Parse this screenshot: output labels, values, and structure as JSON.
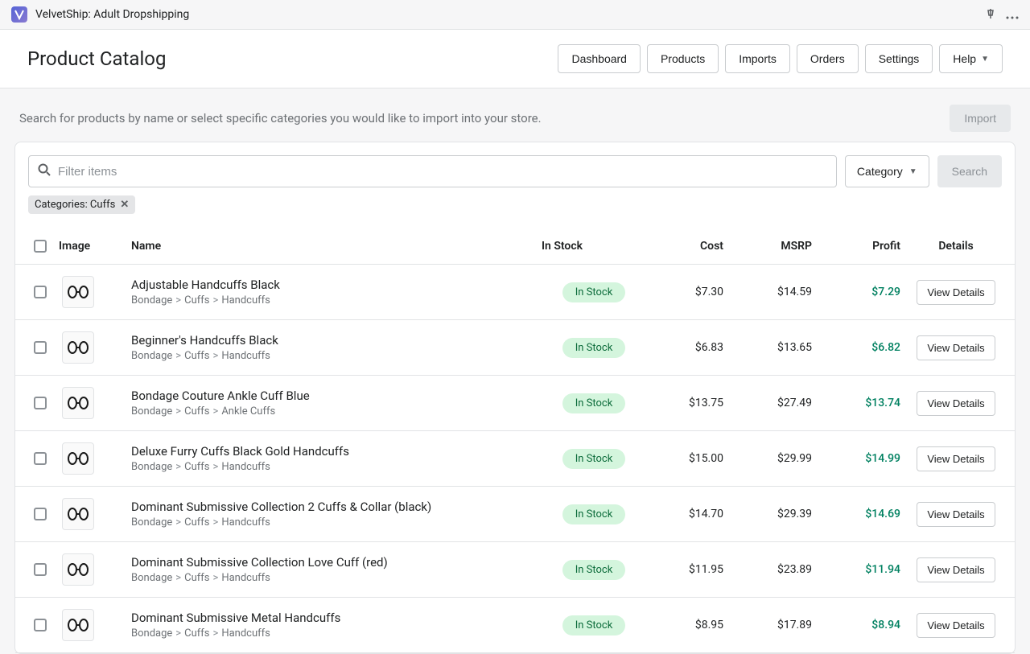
{
  "titlebar": {
    "app_name": "VelvetShip: Adult Dropshipping"
  },
  "header": {
    "page_title": "Product Catalog",
    "nav": {
      "dashboard": "Dashboard",
      "products": "Products",
      "imports": "Imports",
      "orders": "Orders",
      "settings": "Settings",
      "help": "Help"
    }
  },
  "subbar": {
    "text": "Search for products by name or select specific categories you would like to import into your store.",
    "import_label": "Import"
  },
  "filters": {
    "search_placeholder": "Filter items",
    "category_label": "Category",
    "search_label": "Search",
    "chip_label": "Categories: Cuffs"
  },
  "table": {
    "headers": {
      "image": "Image",
      "name": "Name",
      "stock": "In Stock",
      "cost": "Cost",
      "msrp": "MSRP",
      "profit": "Profit",
      "details": "Details"
    },
    "stock_label": "In Stock",
    "details_label": "View Details",
    "rows": [
      {
        "name": "Adjustable Handcuffs Black",
        "crumb1": "Bondage",
        "crumb2": "Cuffs",
        "crumb3": "Handcuffs",
        "cost": "$7.30",
        "msrp": "$14.59",
        "profit": "$7.29"
      },
      {
        "name": "Beginner's Handcuffs Black",
        "crumb1": "Bondage",
        "crumb2": "Cuffs",
        "crumb3": "Handcuffs",
        "cost": "$6.83",
        "msrp": "$13.65",
        "profit": "$6.82"
      },
      {
        "name": "Bondage Couture Ankle Cuff Blue",
        "crumb1": "Bondage",
        "crumb2": "Cuffs",
        "crumb3": "Ankle Cuffs",
        "cost": "$13.75",
        "msrp": "$27.49",
        "profit": "$13.74"
      },
      {
        "name": "Deluxe Furry Cuffs Black Gold Handcuffs",
        "crumb1": "Bondage",
        "crumb2": "Cuffs",
        "crumb3": "Handcuffs",
        "cost": "$15.00",
        "msrp": "$29.99",
        "profit": "$14.99"
      },
      {
        "name": "Dominant Submissive Collection 2 Cuffs & Collar (black)",
        "crumb1": "Bondage",
        "crumb2": "Cuffs",
        "crumb3": "Handcuffs",
        "cost": "$14.70",
        "msrp": "$29.39",
        "profit": "$14.69"
      },
      {
        "name": "Dominant Submissive Collection Love Cuff (red)",
        "crumb1": "Bondage",
        "crumb2": "Cuffs",
        "crumb3": "Handcuffs",
        "cost": "$11.95",
        "msrp": "$23.89",
        "profit": "$11.94"
      },
      {
        "name": "Dominant Submissive Metal Handcuffs",
        "crumb1": "Bondage",
        "crumb2": "Cuffs",
        "crumb3": "Handcuffs",
        "cost": "$8.95",
        "msrp": "$17.89",
        "profit": "$8.94"
      }
    ]
  }
}
